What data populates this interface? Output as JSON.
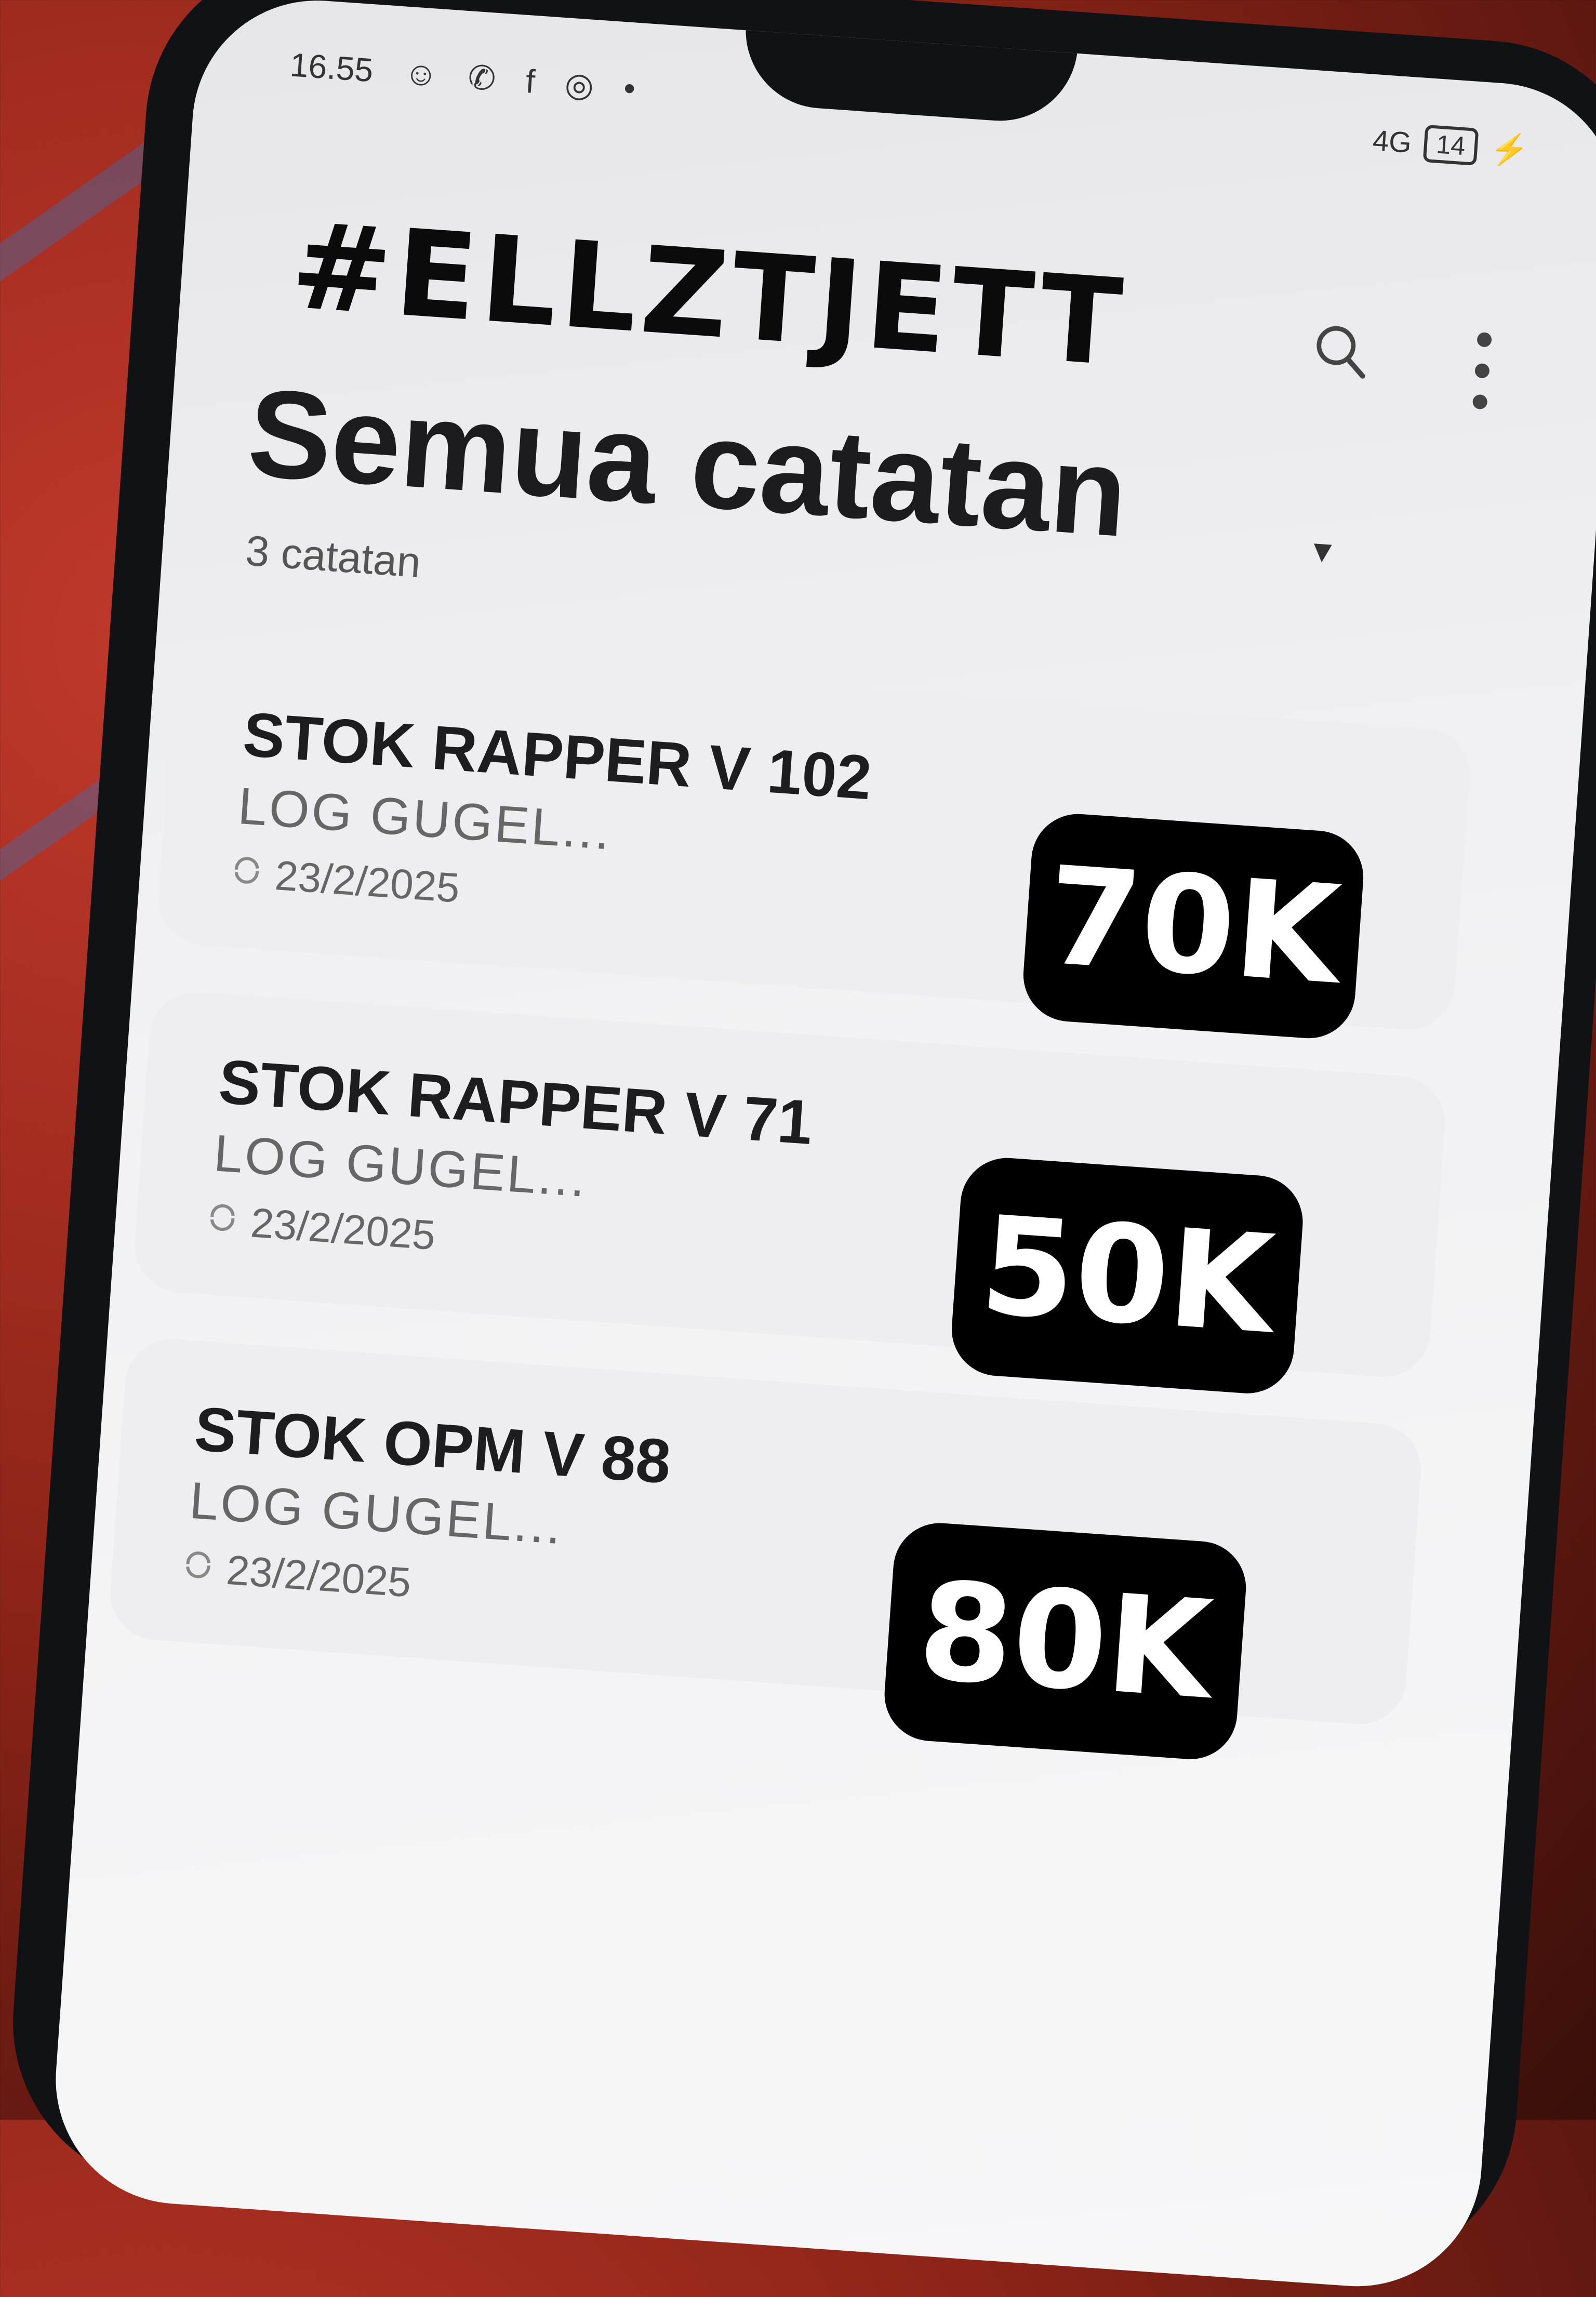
{
  "status_bar": {
    "time": "16.55",
    "notification_icons": [
      "☺",
      "✆",
      "f",
      "◎",
      "•"
    ],
    "network": "4G",
    "battery": "14"
  },
  "overlay": {
    "brand": "#ELLZTJETT"
  },
  "header": {
    "title": "Semua catatan",
    "dropdown_symbol": "▾",
    "note_count": "3 catatan"
  },
  "notes": [
    {
      "title": "STOK RAPPER V 102",
      "preview": "LOG GUGEL...",
      "date": "23/2/2025",
      "price": "70K"
    },
    {
      "title": "STOK RAPPER V 71",
      "preview": "LOG GUGEL...",
      "date": "23/2/2025",
      "price": "50K"
    },
    {
      "title": "STOK OPM V 88",
      "preview": "LOG GUGEL...",
      "date": "23/2/2025",
      "price": "80K"
    }
  ],
  "icons": {
    "search": "search-icon",
    "more": "more-vert-icon",
    "sync": "sync-icon"
  }
}
